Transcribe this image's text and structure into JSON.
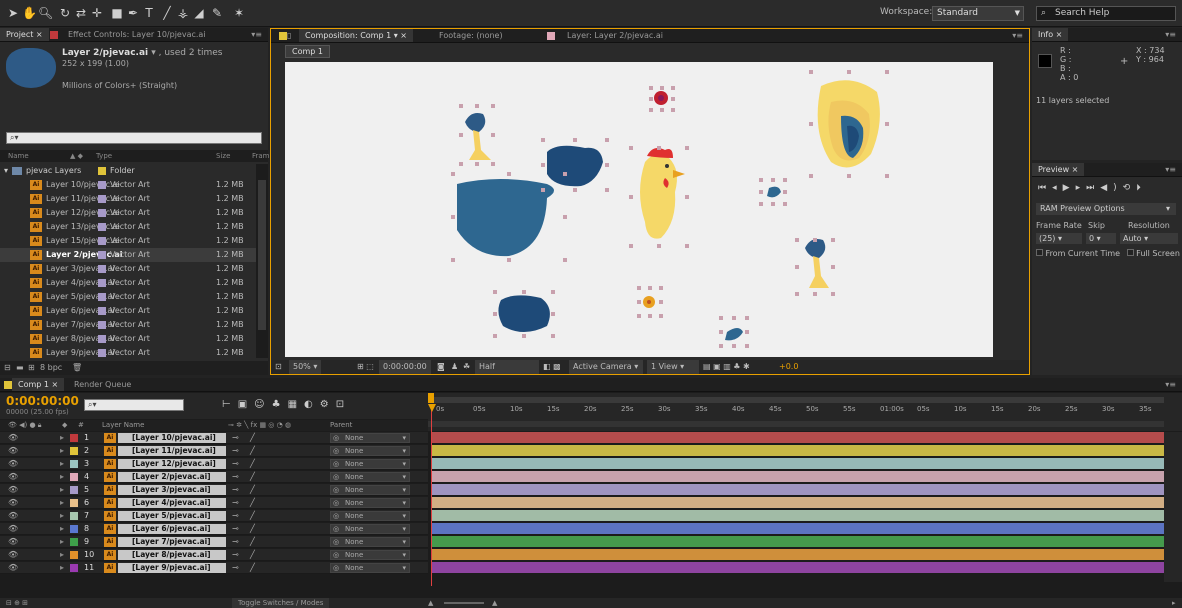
{
  "project_panel": {
    "tab_project": "Project",
    "tab_effect_controls": "Effect Controls: Layer 10/pjevac.ai",
    "selected_item": "Layer 2/pjevac.ai",
    "used_times": "▾ , used 2 times",
    "dimensions": "252 x 199 (1.00)",
    "color_info": "Millions of Colors+ (Straight)",
    "search_placeholder": "⌕▾",
    "columns": {
      "name": "Name",
      "type": "Type",
      "size": "Size",
      "frame": "Fram"
    },
    "folder": {
      "name": "pjevac Layers",
      "type": "Folder"
    },
    "items": [
      {
        "name": "Layer 10/pjevac.ai",
        "type": "Vector Art",
        "size": "1.2 MB",
        "selected": false
      },
      {
        "name": "Layer 11/pjevac.ai",
        "type": "Vector Art",
        "size": "1.2 MB",
        "selected": false
      },
      {
        "name": "Layer 12/pjevac.ai",
        "type": "Vector Art",
        "size": "1.2 MB",
        "selected": false
      },
      {
        "name": "Layer 13/pjevac.ai",
        "type": "Vector Art",
        "size": "1.2 MB",
        "selected": false
      },
      {
        "name": "Layer 15/pjevac.ai",
        "type": "Vector Art",
        "size": "1.2 MB",
        "selected": false
      },
      {
        "name": "Layer 2/pjevac.ai",
        "type": "Vector Art",
        "size": "1.2 MB",
        "selected": true
      },
      {
        "name": "Layer 3/pjevac.ai",
        "type": "Vector Art",
        "size": "1.2 MB",
        "selected": false
      },
      {
        "name": "Layer 4/pjevac.ai",
        "type": "Vector Art",
        "size": "1.2 MB",
        "selected": false
      },
      {
        "name": "Layer 5/pjevac.ai",
        "type": "Vector Art",
        "size": "1.2 MB",
        "selected": false
      },
      {
        "name": "Layer 6/pjevac.ai",
        "type": "Vector Art",
        "size": "1.2 MB",
        "selected": false
      },
      {
        "name": "Layer 7/pjevac.ai",
        "type": "Vector Art",
        "size": "1.2 MB",
        "selected": false
      },
      {
        "name": "Layer 8/pjevac.ai",
        "type": "Vector Art",
        "size": "1.2 MB",
        "selected": false
      },
      {
        "name": "Layer 9/pjevac.ai",
        "type": "Vector Art",
        "size": "1.2 MB",
        "selected": false
      }
    ],
    "bpc": "8 bpc"
  },
  "composition_panel": {
    "tab_comp": "Composition: Comp 1",
    "tab_footage": "Footage: (none)",
    "tab_layer": "Layer: Layer 2/pjevac.ai",
    "breadcrumb": "Comp 1",
    "zoom": "50%",
    "timecode": "0:00:00:00",
    "resolution": "Half",
    "camera": "Active Camera",
    "view": "1 View",
    "exposure": "+0.0"
  },
  "workspace": {
    "label": "Workspace:",
    "value": "Standard",
    "search_placeholder": "Search Help"
  },
  "info_panel": {
    "tab": "Info",
    "r": "R :",
    "g": "G :",
    "b": "B :",
    "a": "A : 0",
    "x": "X : 734",
    "y": "Y : 964",
    "status": "11 layers selected"
  },
  "preview_panel": {
    "tab": "Preview",
    "ram_options": "RAM Preview Options",
    "frame_rate_label": "Frame Rate",
    "skip_label": "Skip",
    "resolution_label": "Resolution",
    "frame_rate": "(25)",
    "skip": "0",
    "resolution": "Auto",
    "from_current": "From Current Time",
    "full_screen": "Full Screen"
  },
  "timeline": {
    "tab_comp": "Comp 1",
    "tab_render": "Render Queue",
    "timecode": "0:00:00:00",
    "fps": "00000 (25.00 fps)",
    "search_placeholder": "⌕▾",
    "col_hash": "#",
    "col_layer_name": "Layer Name",
    "col_parent": "Parent",
    "switch_icons": "⊸ ✲ ╲ fx ▦ ◎ ◔ ◍",
    "ruler": [
      "0s",
      "05s",
      "10s",
      "15s",
      "20s",
      "25s",
      "30s",
      "35s",
      "40s",
      "45s",
      "50s",
      "55s",
      "01:00s",
      "05s",
      "10s",
      "15s",
      "20s",
      "25s",
      "30s",
      "35s"
    ],
    "toggle_label": "Toggle Switches / Modes",
    "layers": [
      {
        "num": "1",
        "name": "[Layer 10/pjevac.ai]",
        "parent": "None",
        "color": "#c0393c",
        "bar": "#b54c4c"
      },
      {
        "num": "2",
        "name": "[Layer 11/pjevac.ai]",
        "parent": "None",
        "color": "#e0c43a",
        "bar": "#c9b845"
      },
      {
        "num": "3",
        "name": "[Layer 12/pjevac.ai]",
        "parent": "None",
        "color": "#9bc4c0",
        "bar": "#97b9b7"
      },
      {
        "num": "4",
        "name": "[Layer 2/pjevac.ai]",
        "parent": "None",
        "color": "#e0a8b8",
        "bar": "#c7a2ad"
      },
      {
        "num": "5",
        "name": "[Layer 3/pjevac.ai]",
        "parent": "None",
        "color": "#a79ac8",
        "bar": "#9f94c0"
      },
      {
        "num": "6",
        "name": "[Layer 4/pjevac.ai]",
        "parent": "None",
        "color": "#e8bf8a",
        "bar": "#d2ae84"
      },
      {
        "num": "7",
        "name": "[Layer 5/pjevac.ai]",
        "parent": "None",
        "color": "#a8c8b0",
        "bar": "#a1bba6"
      },
      {
        "num": "8",
        "name": "[Layer 6/pjevac.ai]",
        "parent": "None",
        "color": "#5a78d0",
        "bar": "#5c74c2"
      },
      {
        "num": "9",
        "name": "[Layer 7/pjevac.ai]",
        "parent": "None",
        "color": "#3ea04a",
        "bar": "#459a4c"
      },
      {
        "num": "10",
        "name": "[Layer 8/pjevac.ai]",
        "parent": "None",
        "color": "#e0902a",
        "bar": "#cf8f3b"
      },
      {
        "num": "11",
        "name": "[Layer 9/pjevac.ai]",
        "parent": "None",
        "color": "#9a3ab0",
        "bar": "#8e44a0"
      }
    ]
  },
  "colors": {
    "accent": "#e8a000",
    "canvas": "#f0f0f0"
  }
}
